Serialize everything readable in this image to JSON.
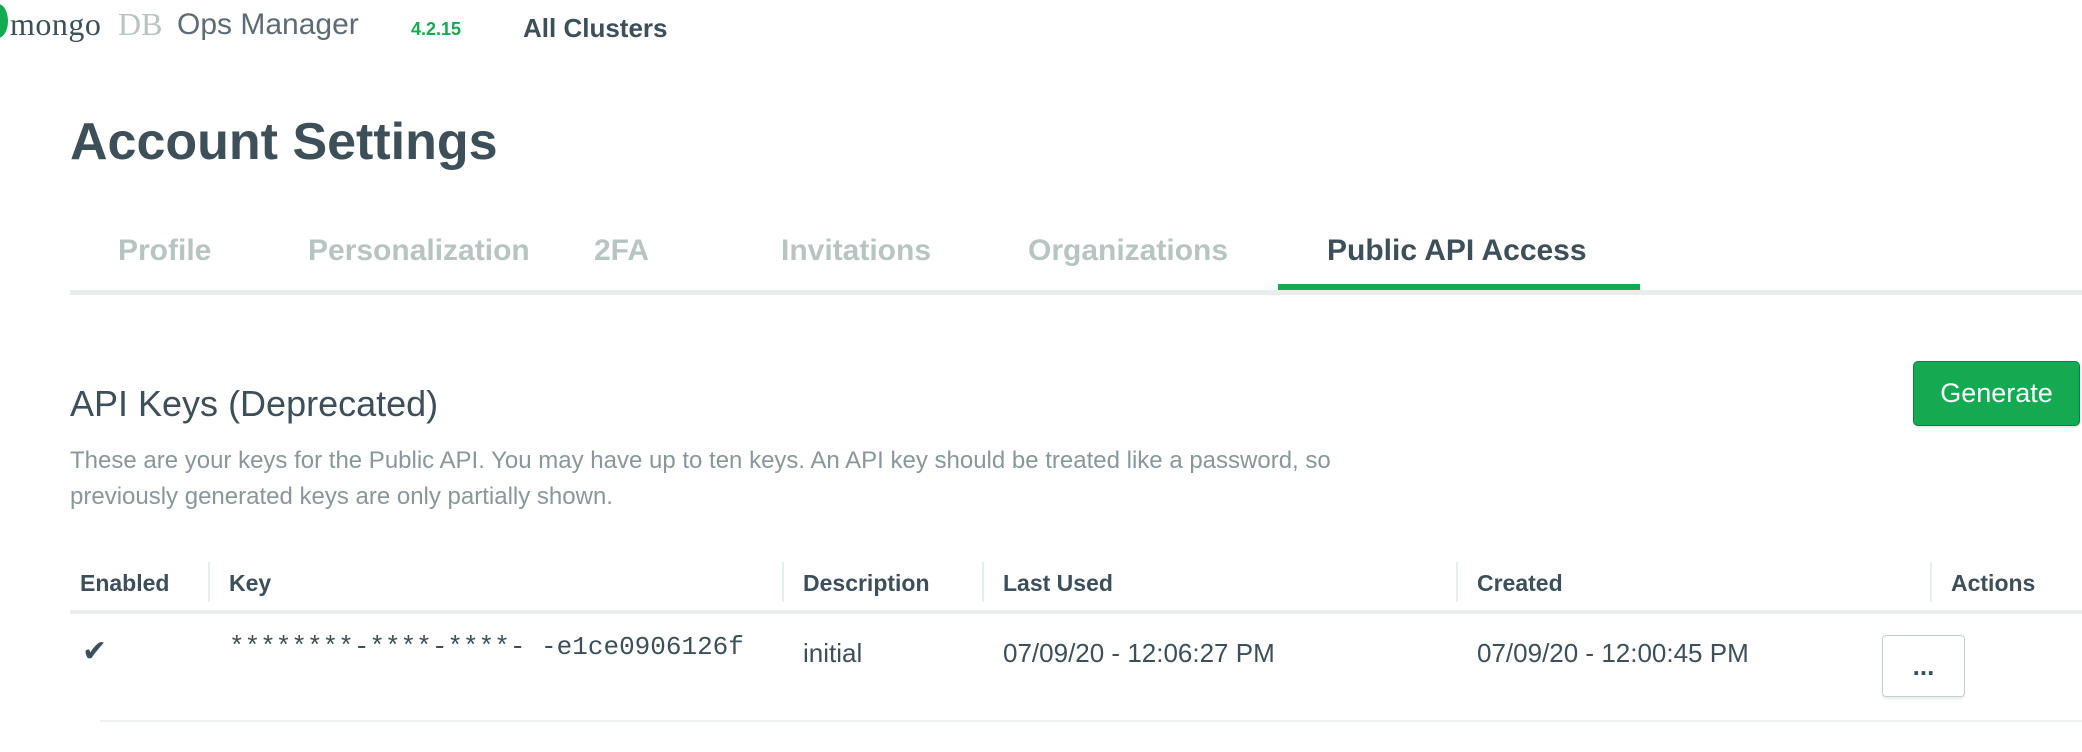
{
  "header": {
    "logo_mongo": "mongo",
    "logo_db": "DB",
    "logo_product": "Ops Manager",
    "version": "4.2.15",
    "nav_all_clusters": "All Clusters"
  },
  "page": {
    "title": "Account Settings"
  },
  "tabs": [
    {
      "label": "Profile",
      "active": false
    },
    {
      "label": "Personalization",
      "active": false
    },
    {
      "label": "2FA",
      "active": false
    },
    {
      "label": "Invitations",
      "active": false
    },
    {
      "label": "Organizations",
      "active": false
    },
    {
      "label": "Public API Access",
      "active": true
    }
  ],
  "api_keys": {
    "title": "API Keys (Deprecated)",
    "description": "These are your keys for the Public API. You may have up to ten keys. An API key should be treated like a password, so previously generated keys are only partially shown.",
    "generate_label": "Generate",
    "columns": [
      "Enabled",
      "Key",
      "Description",
      "Last Used",
      "Created",
      "Actions"
    ],
    "rows": [
      {
        "enabled_icon": "check-icon",
        "enabled_glyph": "✔",
        "key": "********-****-****- -e1ce0906126f",
        "description": "initial",
        "last_used": "07/09/20 - 12:06:27 PM",
        "created": "07/09/20 - 12:00:45 PM",
        "actions_label": "..."
      }
    ]
  },
  "colors": {
    "brand_green": "#13aa52",
    "text_dark": "#3d4f58",
    "text_muted": "#89979b",
    "tab_inactive": "#b8c4c2"
  }
}
